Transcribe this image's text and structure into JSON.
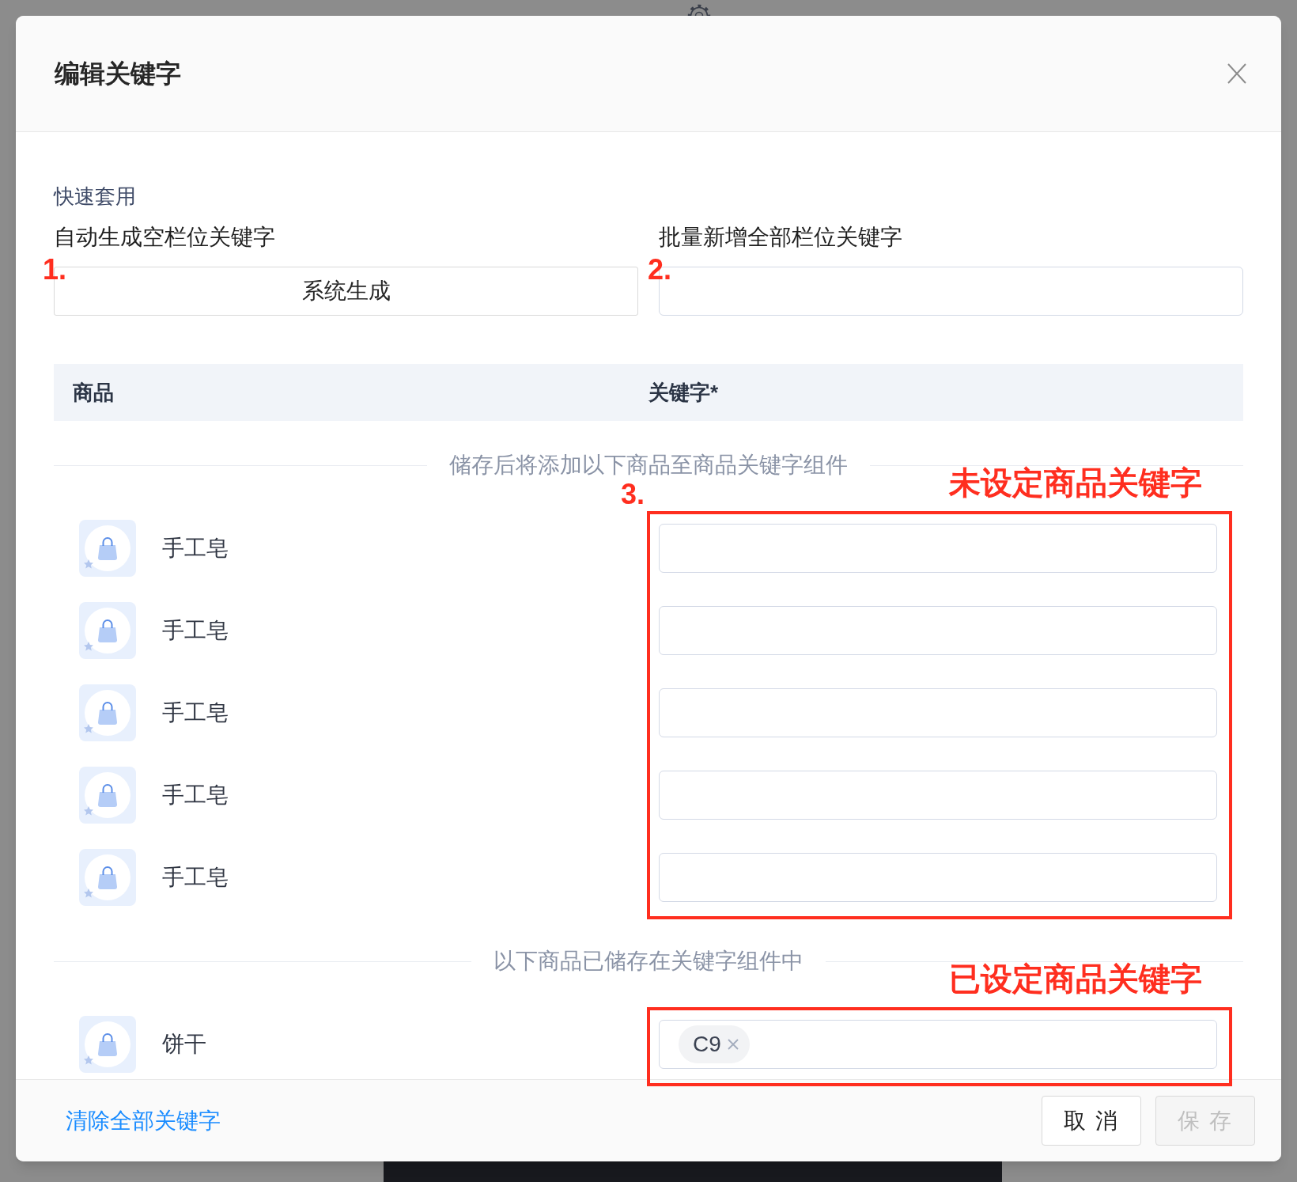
{
  "dialog": {
    "title": "编辑关键字"
  },
  "quick_apply": {
    "heading": "快速套用",
    "fields": [
      {
        "kind": "button",
        "label": "自动生成空栏位关键字",
        "value": "系统生成",
        "marker": "1."
      },
      {
        "kind": "input",
        "label": "批量新增全部栏位关键字",
        "marker": "2."
      }
    ]
  },
  "table": {
    "columns": [
      "商品",
      "关键字*"
    ],
    "groups": [
      {
        "caption": "储存后将添加以下商品至商品关键字组件",
        "marker": "3.",
        "note": "未设定商品关键字",
        "rows": [
          {
            "product": "手工皂"
          },
          {
            "product": "手工皂"
          },
          {
            "product": "手工皂"
          },
          {
            "product": "手工皂"
          },
          {
            "product": "手工皂"
          }
        ]
      },
      {
        "caption": "以下商品已储存在关键字组件中",
        "note": "已设定商品关键字",
        "rows": [
          {
            "product": "饼干",
            "keywords": [
              "C9"
            ]
          }
        ]
      }
    ]
  },
  "footer": {
    "link": "清除全部关键字",
    "buttons": [
      {
        "label": "取 消",
        "disabled": false
      },
      {
        "label": "保 存",
        "disabled": true
      }
    ]
  }
}
